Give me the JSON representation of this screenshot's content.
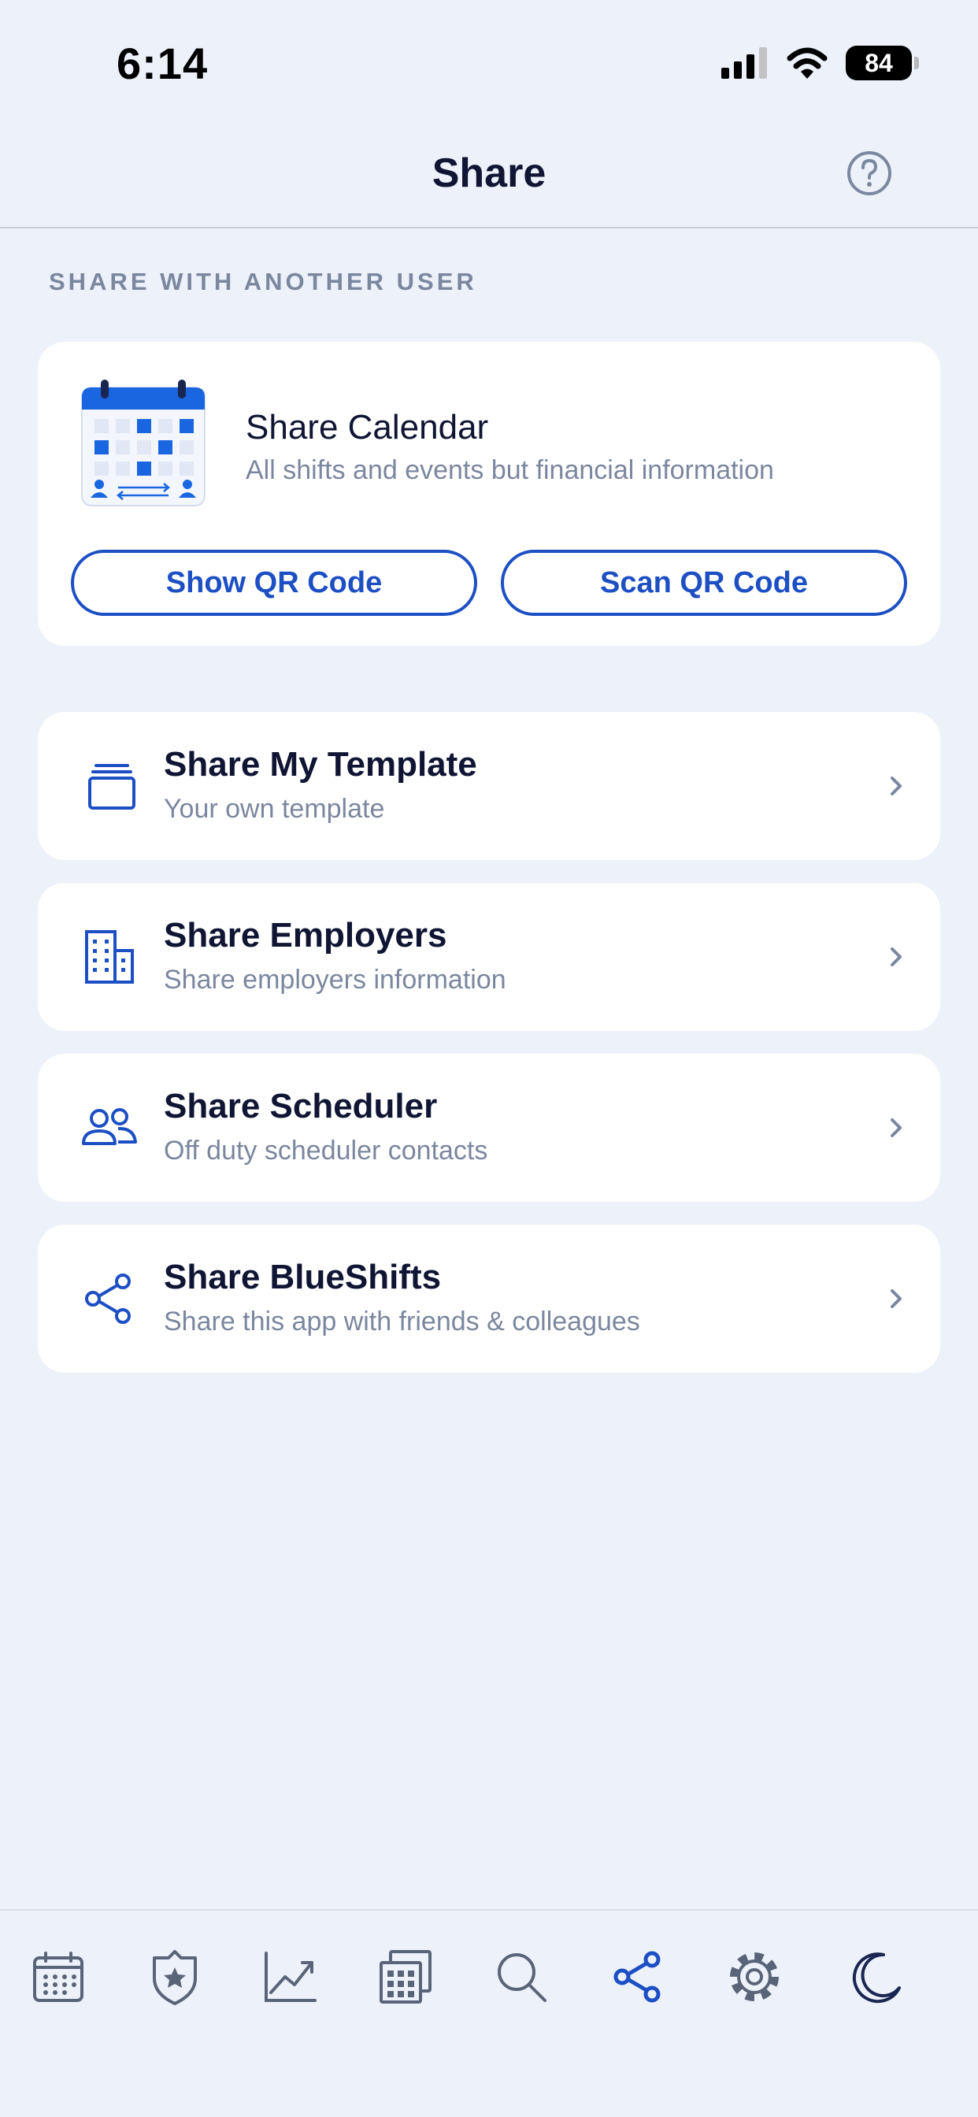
{
  "status_bar": {
    "time": "6:14",
    "battery": "84"
  },
  "nav": {
    "title": "Share"
  },
  "section": {
    "header": "SHARE WITH ANOTHER USER"
  },
  "calendar_card": {
    "title": "Share Calendar",
    "subtitle": "All shifts and events but financial information",
    "show_qr_label": "Show QR Code",
    "scan_qr_label": "Scan QR Code"
  },
  "share_items": [
    {
      "title": "Share My Template",
      "subtitle": "Your own template",
      "icon": "template-icon"
    },
    {
      "title": "Share Employers",
      "subtitle": "Share employers information",
      "icon": "building-icon"
    },
    {
      "title": "Share Scheduler",
      "subtitle": "Off duty scheduler contacts",
      "icon": "people-icon"
    },
    {
      "title": "Share BlueShifts",
      "subtitle": "Share this app with friends & colleagues",
      "icon": "share-icon"
    }
  ],
  "tab_bar": {
    "items": [
      "calendar-icon",
      "badge-icon",
      "chart-icon",
      "calculator-icon",
      "search-icon",
      "share-icon",
      "gear-icon",
      "moon-icon"
    ],
    "active": "share-icon"
  },
  "colors": {
    "accent": "#1d4fc4",
    "background": "#edf1fa",
    "muted_text": "#7b879e",
    "icon_gray": "#5a6478"
  }
}
